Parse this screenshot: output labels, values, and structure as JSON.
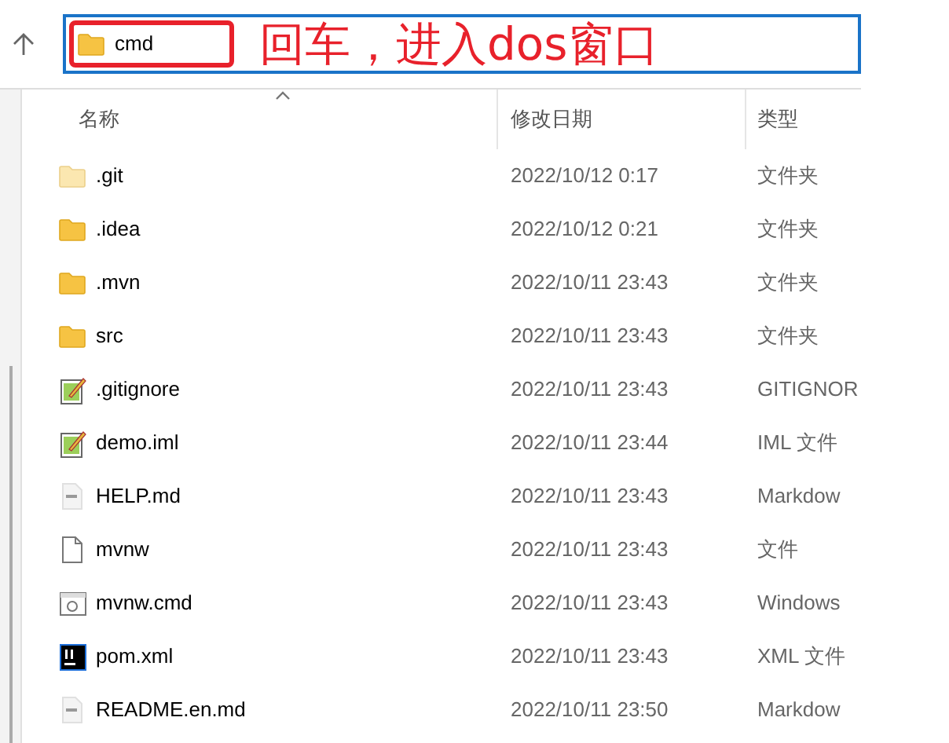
{
  "address_bar": {
    "value": "cmd"
  },
  "annotation": {
    "text": "回车，进入dos窗口"
  },
  "columns": [
    {
      "label": "名称",
      "sorted": true
    },
    {
      "label": "修改日期",
      "sorted": false
    },
    {
      "label": "类型",
      "sorted": false
    }
  ],
  "files": [
    {
      "name": ".git",
      "modified": "2022/10/12 0:17",
      "type": "文件夹",
      "kind": "hidden-folder"
    },
    {
      "name": ".idea",
      "modified": "2022/10/12 0:21",
      "type": "文件夹",
      "kind": "folder"
    },
    {
      "name": ".mvn",
      "modified": "2022/10/11 23:43",
      "type": "文件夹",
      "kind": "folder"
    },
    {
      "name": "src",
      "modified": "2022/10/11 23:43",
      "type": "文件夹",
      "kind": "folder"
    },
    {
      "name": ".gitignore",
      "modified": "2022/10/11 23:43",
      "type": "GITIGNOR",
      "kind": "notepad"
    },
    {
      "name": "demo.iml",
      "modified": "2022/10/11 23:44",
      "type": "IML 文件",
      "kind": "notepad"
    },
    {
      "name": "HELP.md",
      "modified": "2022/10/11 23:43",
      "type": "Markdow",
      "kind": "markdown"
    },
    {
      "name": "mvnw",
      "modified": "2022/10/11 23:43",
      "type": "文件",
      "kind": "blank"
    },
    {
      "name": "mvnw.cmd",
      "modified": "2022/10/11 23:43",
      "type": "Windows",
      "kind": "script"
    },
    {
      "name": "pom.xml",
      "modified": "2022/10/11 23:43",
      "type": "XML 文件",
      "kind": "intellij"
    },
    {
      "name": "README.en.md",
      "modified": "2022/10/11 23:50",
      "type": "Markdow",
      "kind": "markdown"
    }
  ]
}
